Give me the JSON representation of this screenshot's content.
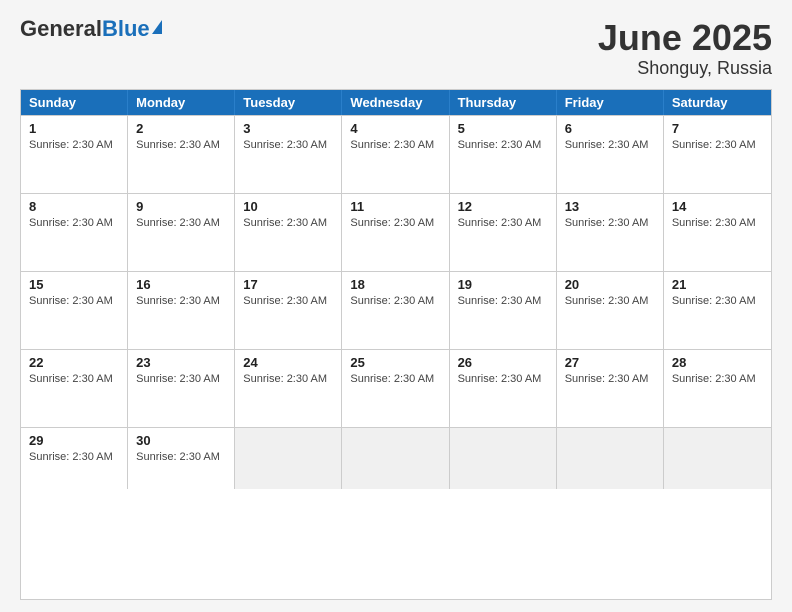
{
  "header": {
    "logo_general": "General",
    "logo_blue": "Blue",
    "title": "June 2025",
    "subtitle": "Shonguy, Russia"
  },
  "calendar": {
    "days_of_week": [
      "Sunday",
      "Monday",
      "Tuesday",
      "Wednesday",
      "Thursday",
      "Friday",
      "Saturday"
    ],
    "sunrise_text": "Sunrise: 2:30 AM",
    "weeks": [
      [
        {
          "day": "1",
          "info": "Sunrise: 2:30 AM",
          "empty": false
        },
        {
          "day": "2",
          "info": "Sunrise: 2:30 AM",
          "empty": false
        },
        {
          "day": "3",
          "info": "Sunrise: 2:30 AM",
          "empty": false
        },
        {
          "day": "4",
          "info": "Sunrise: 2:30 AM",
          "empty": false
        },
        {
          "day": "5",
          "info": "Sunrise: 2:30 AM",
          "empty": false
        },
        {
          "day": "6",
          "info": "Sunrise: 2:30 AM",
          "empty": false
        },
        {
          "day": "7",
          "info": "Sunrise: 2:30 AM",
          "empty": false
        }
      ],
      [
        {
          "day": "8",
          "info": "Sunrise: 2:30 AM",
          "empty": false
        },
        {
          "day": "9",
          "info": "Sunrise: 2:30 AM",
          "empty": false
        },
        {
          "day": "10",
          "info": "Sunrise: 2:30 AM",
          "empty": false
        },
        {
          "day": "11",
          "info": "Sunrise: 2:30 AM",
          "empty": false
        },
        {
          "day": "12",
          "info": "Sunrise: 2:30 AM",
          "empty": false
        },
        {
          "day": "13",
          "info": "Sunrise: 2:30 AM",
          "empty": false
        },
        {
          "day": "14",
          "info": "Sunrise: 2:30 AM",
          "empty": false
        }
      ],
      [
        {
          "day": "15",
          "info": "Sunrise: 2:30 AM",
          "empty": false
        },
        {
          "day": "16",
          "info": "Sunrise: 2:30 AM",
          "empty": false
        },
        {
          "day": "17",
          "info": "Sunrise: 2:30 AM",
          "empty": false
        },
        {
          "day": "18",
          "info": "Sunrise: 2:30 AM",
          "empty": false
        },
        {
          "day": "19",
          "info": "Sunrise: 2:30 AM",
          "empty": false
        },
        {
          "day": "20",
          "info": "Sunrise: 2:30 AM",
          "empty": false
        },
        {
          "day": "21",
          "info": "Sunrise: 2:30 AM",
          "empty": false
        }
      ],
      [
        {
          "day": "22",
          "info": "Sunrise: 2:30 AM",
          "empty": false
        },
        {
          "day": "23",
          "info": "Sunrise: 2:30 AM",
          "empty": false
        },
        {
          "day": "24",
          "info": "Sunrise: 2:30 AM",
          "empty": false
        },
        {
          "day": "25",
          "info": "Sunrise: 2:30 AM",
          "empty": false
        },
        {
          "day": "26",
          "info": "Sunrise: 2:30 AM",
          "empty": false
        },
        {
          "day": "27",
          "info": "Sunrise: 2:30 AM",
          "empty": false
        },
        {
          "day": "28",
          "info": "Sunrise: 2:30 AM",
          "empty": false
        }
      ],
      [
        {
          "day": "29",
          "info": "Sunrise: 2:30 AM",
          "empty": false
        },
        {
          "day": "30",
          "info": "Sunrise: 2:30 AM",
          "empty": false
        },
        {
          "day": "",
          "info": "",
          "empty": true
        },
        {
          "day": "",
          "info": "",
          "empty": true
        },
        {
          "day": "",
          "info": "",
          "empty": true
        },
        {
          "day": "",
          "info": "",
          "empty": true
        },
        {
          "day": "",
          "info": "",
          "empty": true
        }
      ]
    ]
  }
}
